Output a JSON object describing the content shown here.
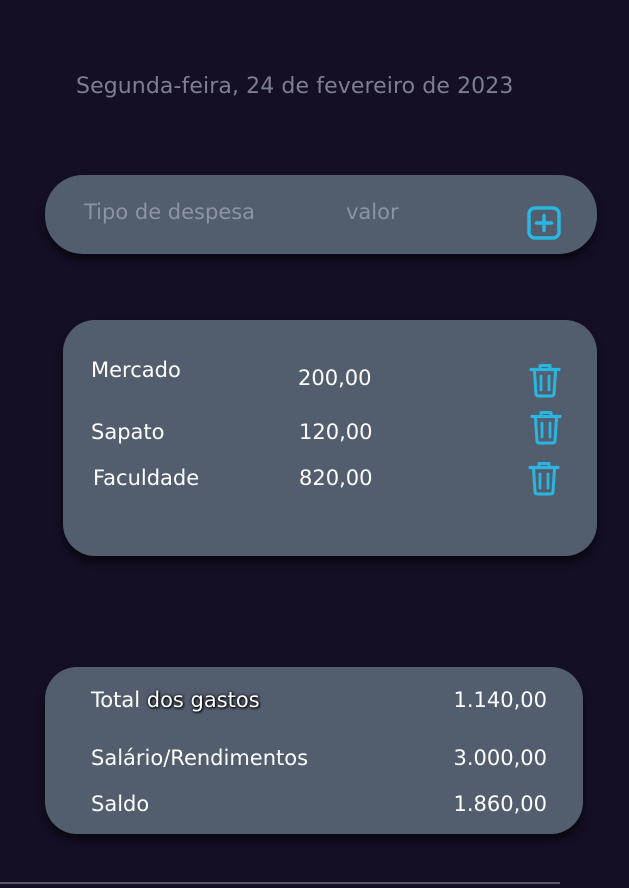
{
  "date_label": "Segunda-feira, 24 de fevereiro de 2023",
  "form": {
    "type_placeholder": "Tipo de despesa",
    "value_placeholder": "valor",
    "add_icon": "plus-square-icon"
  },
  "expenses": [
    {
      "name": "Mercado",
      "value": "200,00",
      "delete_icon": "trash-icon"
    },
    {
      "name": "Sapato",
      "value": "120,00",
      "delete_icon": "trash-icon"
    },
    {
      "name": "Faculdade",
      "value": "820,00",
      "delete_icon": "trash-icon"
    }
  ],
  "summary": {
    "total_label_part1": "Total ",
    "total_label_part2": "dos gastos",
    "total_value": "1.140,00",
    "income_label": "Salário/Rendimentos",
    "income_value": "3.000,00",
    "balance_label": "Saldo",
    "balance_value": "1.860,00"
  },
  "colors": {
    "background": "#140f24",
    "card": "#525d6e",
    "accent": "#29b6e0",
    "muted_text": "#7d7f90"
  }
}
